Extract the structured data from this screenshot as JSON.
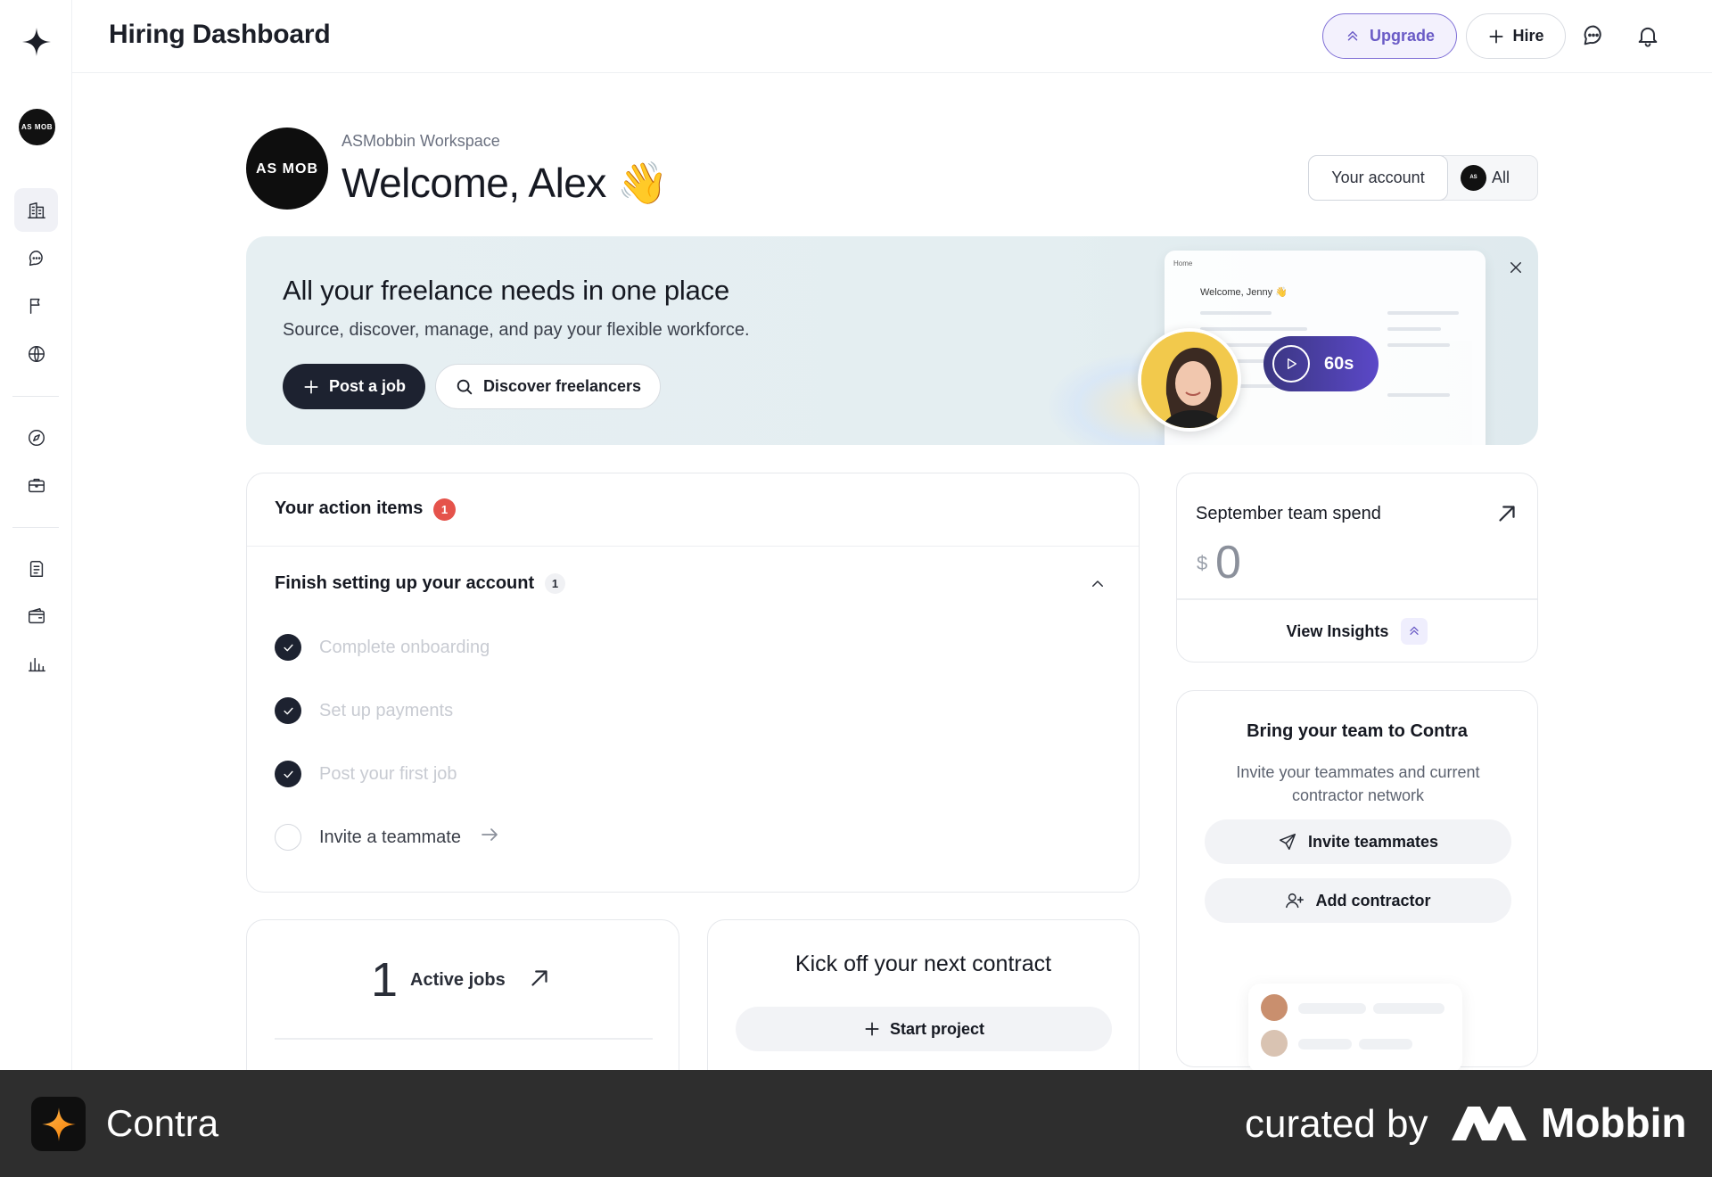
{
  "header": {
    "title": "Hiring Dashboard",
    "upgrade_label": "Upgrade",
    "hire_label": "Hire"
  },
  "sidebar": {
    "workspace_initials": "AS MOB",
    "items": [
      {
        "icon": "building-icon",
        "active": true
      },
      {
        "icon": "chat-icon"
      },
      {
        "icon": "flag-icon"
      },
      {
        "icon": "globe-icon"
      },
      {
        "icon": "compass-icon"
      },
      {
        "icon": "briefcase-icon"
      },
      {
        "icon": "document-icon"
      },
      {
        "icon": "wallet-icon"
      },
      {
        "icon": "bar-chart-icon"
      }
    ]
  },
  "welcome": {
    "workspace_name": "ASMobbin Workspace",
    "avatar_text": "AS MOB",
    "greeting": "Welcome, Alex",
    "emoji": "👋",
    "account_label": "Your account",
    "all_label": "All"
  },
  "banner": {
    "title": "All your freelance needs in one place",
    "subtitle": "Source, discover, manage, and pay your flexible workforce.",
    "post_job_label": "Post a job",
    "discover_label": "Discover freelancers",
    "video_duration": "60s",
    "preview_home": "Home",
    "preview_welcome": "Welcome, Jenny 👋"
  },
  "action_items": {
    "title": "Your action items",
    "count": "1",
    "section_title": "Finish setting up your account",
    "section_count": "1",
    "tasks": [
      {
        "label": "Complete onboarding",
        "done": true
      },
      {
        "label": "Set up payments",
        "done": true
      },
      {
        "label": "Post your first job",
        "done": true
      },
      {
        "label": "Invite a teammate",
        "done": false
      }
    ]
  },
  "spend": {
    "title": "September team spend",
    "currency": "$",
    "value": "0",
    "link_label": "View Insights"
  },
  "team": {
    "title": "Bring your team to Contra",
    "subtitle": "Invite your teammates and current contractor network",
    "invite_label": "Invite teammates",
    "add_contractor_label": "Add contractor"
  },
  "jobs": {
    "count": "1",
    "label": "Active jobs"
  },
  "kickoff": {
    "title": "Kick off your next contract",
    "start_label": "Start project"
  },
  "footer": {
    "app_name": "Contra",
    "curated_label": "curated by",
    "brand_name": "Mobbin"
  },
  "colors": {
    "accent": "#6a5bc6",
    "dark": "#1d2230",
    "badge_red": "#e5534b",
    "banner_bg": "#e4eef1"
  }
}
